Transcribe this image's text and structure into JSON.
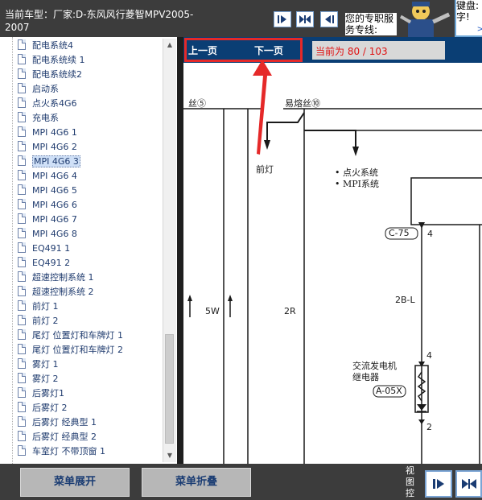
{
  "header": {
    "car_type": "当前车型：厂家:D-东风风行菱智MPV2005-2007",
    "hotline": "您的专职服务专线:",
    "bubble_text": "键盘:字!",
    "bubble_more": ">"
  },
  "menu": {
    "items": [
      {
        "label": "配电系统4"
      },
      {
        "label": "配电系统续 1"
      },
      {
        "label": "配电系统续2"
      },
      {
        "label": "启动系"
      },
      {
        "label": "点火系4G6"
      },
      {
        "label": "充电系"
      },
      {
        "label": "MPI 4G6 1"
      },
      {
        "label": "MPI 4G6 2"
      },
      {
        "label": "MPI 4G6 3"
      },
      {
        "label": "MPI 4G6 4"
      },
      {
        "label": "MPI 4G6 5"
      },
      {
        "label": "MPI 4G6 6"
      },
      {
        "label": "MPI 4G6 7"
      },
      {
        "label": "MPI 4G6 8"
      },
      {
        "label": "EQ491 1"
      },
      {
        "label": "EQ491 2"
      },
      {
        "label": "超速控制系统 1"
      },
      {
        "label": "超速控制系统 2"
      },
      {
        "label": "前灯 1"
      },
      {
        "label": "前灯 2"
      },
      {
        "label": "尾灯 位置灯和车牌灯 1"
      },
      {
        "label": "尾灯 位置灯和车牌灯 2"
      },
      {
        "label": "雾灯 1"
      },
      {
        "label": "雾灯 2"
      },
      {
        "label": "后雾灯1"
      },
      {
        "label": "后雾灯 2"
      },
      {
        "label": "后雾灯 经典型 1"
      },
      {
        "label": "后雾灯 经典型 2"
      },
      {
        "label": "车室灯 不带顶窗 1"
      }
    ],
    "selected_index": 8
  },
  "viewer": {
    "prev_label": "上一页",
    "next_label": "下一页",
    "page_info": "当前为 80 / 103"
  },
  "diagram": {
    "fuse5": "丝⑤",
    "fuse10": "易熔丝⑩",
    "headlight": "前灯",
    "ignition": "• 点火系统",
    "mpi": "• MPI系统",
    "conn_c75": "C-75",
    "pin4_top": "4",
    "wire_2bl": "2B-L",
    "wire_5w": "5W",
    "wire_2r": "2R",
    "alt_relay_1": "交流发电机",
    "alt_relay_2": "继电器",
    "pin4_relay": "4",
    "relay_code": "A-05X",
    "pin2_relay": "2"
  },
  "bottom": {
    "expand_label": "菜单展开",
    "collapse_label": "菜单折叠",
    "view_ctrl": "视图控"
  }
}
